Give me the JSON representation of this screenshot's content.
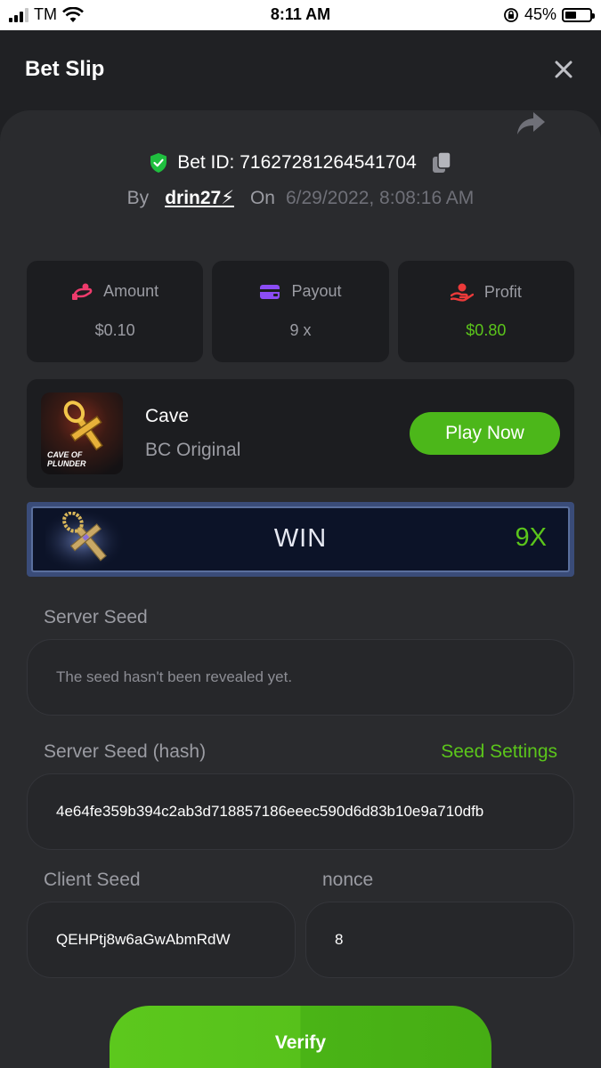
{
  "status_bar": {
    "carrier": "TM",
    "time": "8:11 AM",
    "battery": "45%",
    "battery_level": 0.45
  },
  "header": {
    "title": "Bet Slip"
  },
  "bet": {
    "id_label": "Bet ID: 716272812645417​04",
    "by_label": "By",
    "username": "drin27⚡",
    "on_label": "On",
    "date": "6/29/2022, 8:08:16 AM"
  },
  "stats": {
    "amount_label": "Amount",
    "amount_value": "$0.10",
    "payout_label": "Payout",
    "payout_value": "9 x",
    "profit_label": "Profit",
    "profit_value": "$0.80"
  },
  "game": {
    "name": "Cave",
    "provider": "BC Original",
    "thumb_line1": "CAVE OF",
    "thumb_line2": "PLUNDER",
    "play_label": "Play Now"
  },
  "result": {
    "outcome": "WIN",
    "multiplier": "9X"
  },
  "server_seed": {
    "label": "Server Seed",
    "value": "The seed hasn't been revealed yet."
  },
  "server_seed_hash": {
    "label": "Server Seed (hash)",
    "settings_link": "Seed Settings",
    "value": "4e64fe359b394c2ab3d718857186eeec590d6d83b10e9a710dfb"
  },
  "client_seed": {
    "label": "Client Seed",
    "value": "QEHPtj8w6aGwAbmRdW"
  },
  "nonce": {
    "label": "nonce",
    "value": "8"
  },
  "actions": {
    "verify_label": "Verify"
  },
  "colors": {
    "accent_green": "#5bc51b",
    "button_green": "#4cb71a",
    "background": "#1f2023",
    "panel": "#2a2b2e",
    "card": "#1c1d20"
  }
}
